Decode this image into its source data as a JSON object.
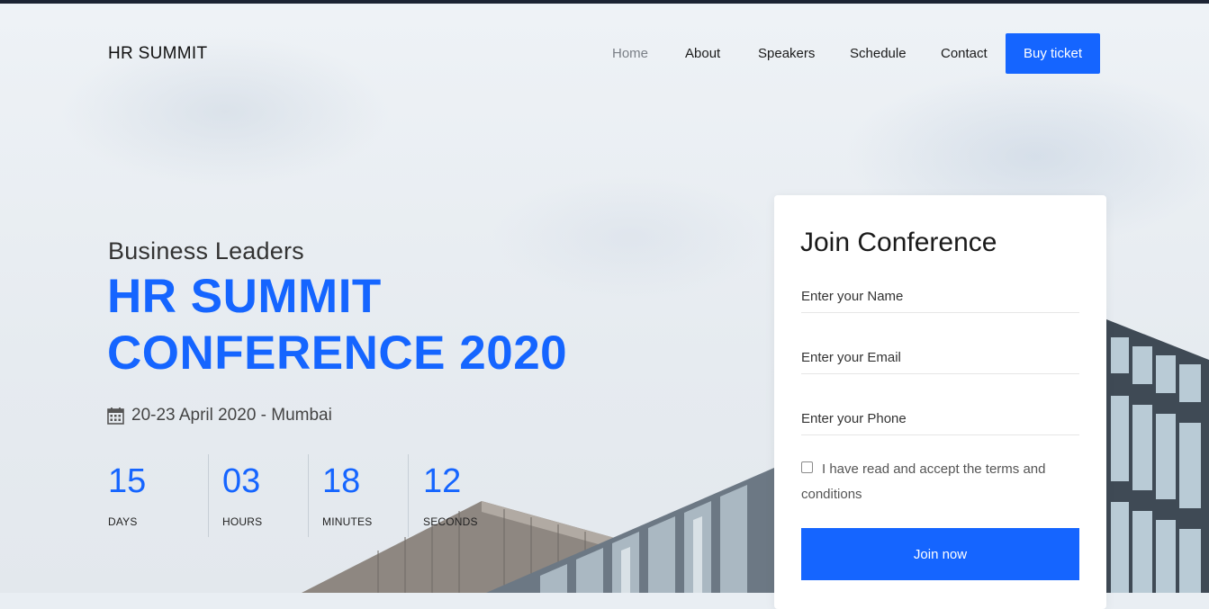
{
  "brand": "HR SUMMIT",
  "nav": {
    "items": [
      "Home",
      "About",
      "Speakers",
      "Schedule",
      "Contact"
    ],
    "active": "Home",
    "cta": "Buy ticket"
  },
  "hero": {
    "subtitle": "Business Leaders",
    "title_line1": "HR SUMMIT",
    "title_line2": "CONFERENCE 2020",
    "date_location": "20-23 April 2020 - Mumbai",
    "calendar_icon": "calendar-icon"
  },
  "countdown": [
    {
      "value": "15",
      "label": "DAYS"
    },
    {
      "value": "03",
      "label": "HOURS"
    },
    {
      "value": "18",
      "label": "MINUTES"
    },
    {
      "value": "12",
      "label": "SECONDS"
    }
  ],
  "form": {
    "title": "Join Conference",
    "name_placeholder": "Enter your Name",
    "email_placeholder": "Enter your Email",
    "phone_placeholder": "Enter your Phone",
    "terms_text": "I have read and accept the terms and conditions",
    "submit": "Join now"
  },
  "colors": {
    "accent": "#1565ff",
    "topbar": "#1c2333"
  }
}
